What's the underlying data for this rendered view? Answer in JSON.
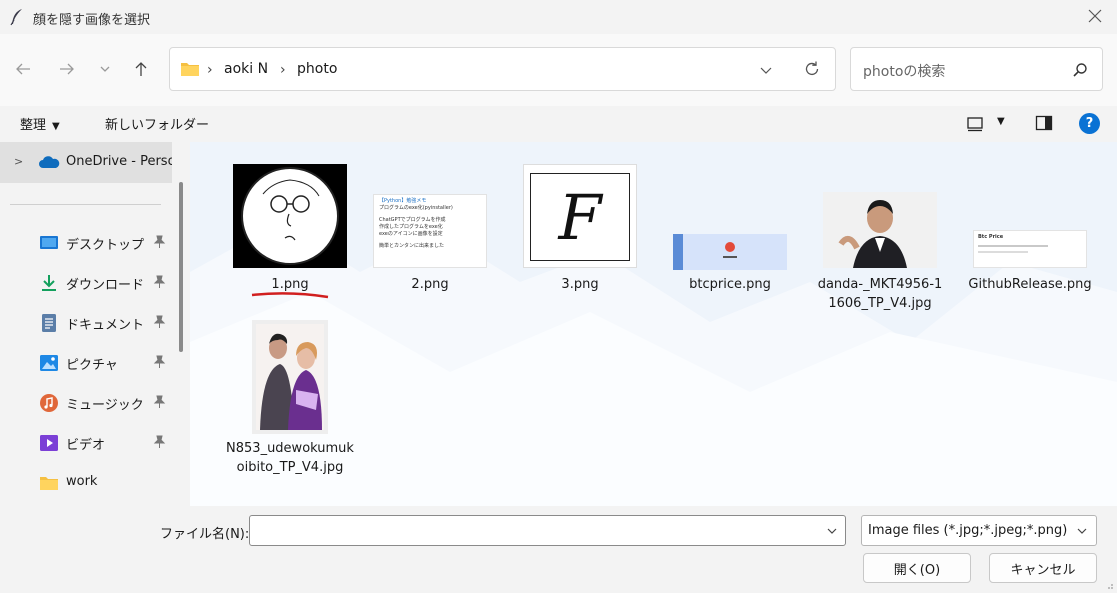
{
  "window": {
    "title": "顔を隠す画像を選択"
  },
  "address": {
    "crumbs": [
      "aoki N",
      "photo"
    ],
    "separator": "›"
  },
  "search": {
    "placeholder": "photoの検索"
  },
  "commands": {
    "organize": "整理",
    "new_folder": "新しいフォルダー",
    "help": "?"
  },
  "sidebar": {
    "onedrive": "OneDrive - Personal",
    "items": [
      {
        "label": "デスクトップ",
        "icon": "desktop-icon",
        "pinned": true
      },
      {
        "label": "ダウンロード",
        "icon": "download-icon",
        "pinned": true
      },
      {
        "label": "ドキュメント",
        "icon": "document-icon",
        "pinned": true
      },
      {
        "label": "ピクチャ",
        "icon": "pictures-icon",
        "pinned": true
      },
      {
        "label": "ミュージック",
        "icon": "music-icon",
        "pinned": true
      },
      {
        "label": "ビデオ",
        "icon": "video-icon",
        "pinned": true
      },
      {
        "label": "work",
        "icon": "folder-icon",
        "pinned": false
      }
    ]
  },
  "files": [
    {
      "name": "1.png",
      "selected_underline": true
    },
    {
      "name": "2.png"
    },
    {
      "name": "3.png",
      "glyph": "F"
    },
    {
      "name": "btcprice.png"
    },
    {
      "name": "danda-_MKT4956-11606_TP_V4.jpg"
    },
    {
      "name": "GithubRelease.png"
    },
    {
      "name": "N853_udewokumukoibito_TP_V4.jpg"
    }
  ],
  "thumb2": {
    "line1": "【Python】勉強メモ",
    "line2": "プログラムのexe化(pyinstaller)",
    "bullets": [
      "ChatGPTでプログラムを作成",
      "作成したプログラムをexe化",
      "exeのアイコンに画像を設定"
    ],
    "footer": "簡単とカンタンに出来ました"
  },
  "thumb6": {
    "title": "Btc Price"
  },
  "bottom": {
    "filename_label": "ファイル名(N):",
    "filename_value": "",
    "filetype": "Image files (*.jpg;*.jpeg;*.png)",
    "open": "開く(O)",
    "cancel": "キャンセル"
  },
  "colors": {
    "accent": "#0a72d4",
    "underline": "#d11f1f"
  }
}
